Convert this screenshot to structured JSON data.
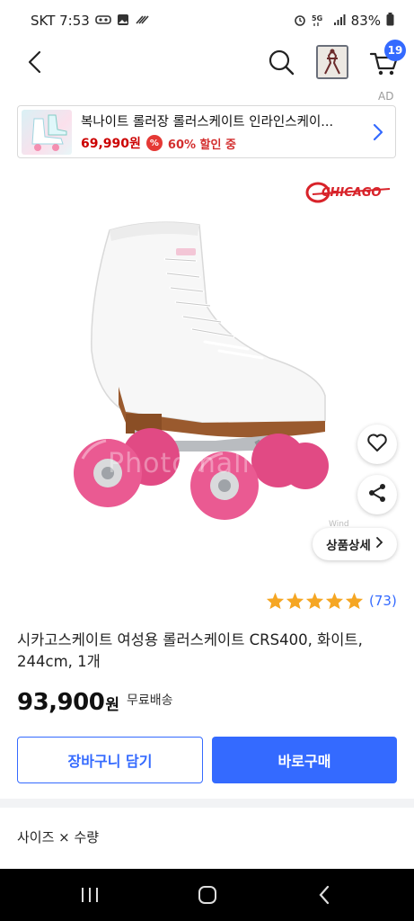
{
  "status_bar": {
    "carrier_time": "SKT 7:53",
    "battery": "83%",
    "icons": [
      "vr-icon",
      "gallery-icon",
      "bolt-icon",
      "alarm-icon",
      "5g-icon",
      "signal-icon",
      "battery-icon"
    ]
  },
  "top_nav": {
    "icons": [
      "back-icon",
      "search-icon",
      "recent-product-thumb",
      "cart-icon"
    ],
    "cart_count": "19"
  },
  "ad": {
    "label": "AD",
    "title": "복나이트 롤러장 롤러스케이트 인라인스케이...",
    "price": "69,990원",
    "discount": "60% 할인 중"
  },
  "product": {
    "brand_logo_text": "CHICAGO",
    "watermark": "Photomall",
    "wind_text": "Wind",
    "detail_button": "상품상세",
    "rating_value": 5,
    "rating_count": "(73)",
    "title": "시카고스케이트 여성용 롤러스케이트 CRS400, 화이트, 244cm, 1개",
    "price": "93,900",
    "price_unit": "원",
    "shipping": "무료배송"
  },
  "actions": {
    "add_to_cart": "장바구니 담기",
    "buy_now": "바로구매"
  },
  "options": {
    "label": "사이즈 × 수량"
  },
  "colors": {
    "accent": "#346aff",
    "star": "#f5a623",
    "wheel": "#e8588a",
    "price_red": "#c00000"
  }
}
